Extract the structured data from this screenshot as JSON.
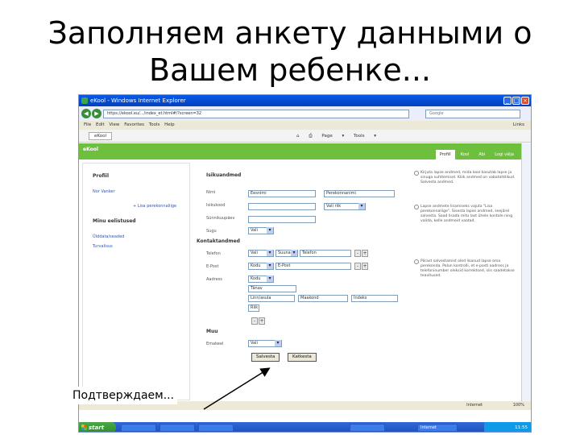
{
  "slide": {
    "title_line1": "Заполняем анкету данными о",
    "title_line2": "Вашем ребенке...",
    "caption": "Подтверждаем..."
  },
  "browser": {
    "window_title": "eKool - Windows Internet Explorer",
    "url": "https://ekool.eu/.../index_et.html#/?screen=32",
    "search_placeholder": "Google",
    "menu": [
      "File",
      "Edit",
      "View",
      "Favorites",
      "Tools",
      "Help"
    ],
    "links_label": "Links",
    "tab_label": "eKool",
    "tools": [
      "Page ▾",
      "Tools ▾"
    ],
    "status_left": "",
    "status_zone": "Internet",
    "status_zoom": "100%"
  },
  "app": {
    "logo": "eKool",
    "tabs": [
      "Profiil",
      "Kool",
      "Abi",
      "Logi välja"
    ],
    "left": {
      "profile_title": "Profiil",
      "profile_link": "Nor Vanker",
      "add_parent_link": "+ Lisa perekonnaliige",
      "recent_title": "Minu eelistused",
      "link1": "Ülddata/seaded",
      "link2": "Turvalisus"
    },
    "form": {
      "section_personal": "Isikuandmed",
      "label_name": "Nimi",
      "value_first": "Eesnimi",
      "value_last": "Perekonnanimi",
      "label_id": "Isikukood",
      "select_country": "Vali riik",
      "label_birth": "Sünnikuupäev",
      "label_gender": "Sugu",
      "select_gender": "Vali",
      "section_contact": "Kontaktandmed",
      "label_phone": "Telefon",
      "select_phone1": "Vali",
      "select_phone2": "Suunas",
      "value_phone": "Telefon",
      "label_email": "E-Post",
      "select_email": "Kodu",
      "value_email": "E-Post",
      "label_address": "Aadress",
      "select_address": "Kodu",
      "value_street": "Tänav",
      "value_city": "Linn/asula",
      "value_county": "Maakond",
      "value_zip": "Indeks",
      "value_country": "Riik",
      "section_other": "Muu",
      "label_lang": "Emakeel",
      "select_lang": "Vali",
      "btn_save": "Salvesta",
      "btn_cancel": "Katkesta"
    },
    "help": {
      "p1": "Kirjuta lapse andmed, mida kool kasutab lapse ja sinuga suhtlemisel. Kõik andmed on vabatahtlikud. Salvesta andmed.",
      "p2": "Lapse andmete lisamiseks vajuta \"Lisa perekonnaliige\". Sisesta lapse andmed, seejärel salvesta. Saad lisada mitu last ühele kontole ning valida, kelle andmeid vaatad.",
      "p3": "Pärast salvestamist oled lisanud lapse oma perekonda. Palun kontrolli, et e-posti aadress ja telefoninumber oleksid korrektsed, siis saadetakse teavitused."
    }
  },
  "taskbar": {
    "start": "start",
    "items": [
      "",
      "",
      "",
      "",
      "Internet"
    ],
    "tray_time": "11:55"
  }
}
